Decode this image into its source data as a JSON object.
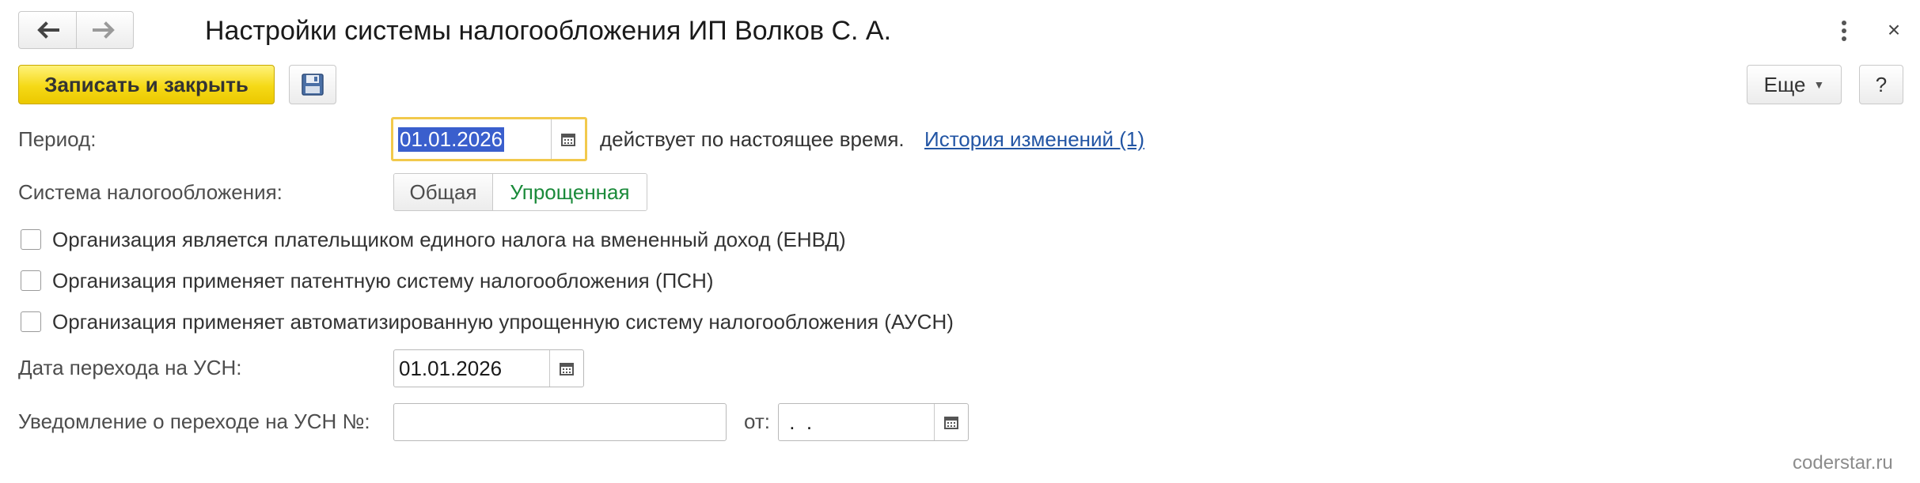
{
  "window": {
    "title": "Настройки системы налогообложения ИП Волков С. А.",
    "close_symbol": "×"
  },
  "toolbar": {
    "save_close_label": "Записать и закрыть",
    "more_label": "Еще",
    "help_label": "?"
  },
  "period": {
    "label": "Период:",
    "value": "01.01.2026",
    "status_text": "действует по настоящее время.",
    "history_link": "История изменений (1)"
  },
  "tax_system": {
    "label": "Система налогообложения:",
    "options": [
      "Общая",
      "Упрощенная"
    ],
    "selected": "Упрощенная"
  },
  "checkboxes": [
    {
      "label": "Организация является плательщиком единого налога на вмененный доход (ЕНВД)",
      "checked": false
    },
    {
      "label": "Организация применяет патентную систему налогообложения (ПСН)",
      "checked": false
    },
    {
      "label": "Организация применяет автоматизированную упрощенную систему налогообложения (АУСН)",
      "checked": false
    }
  ],
  "usn_date": {
    "label": "Дата перехода на УСН:",
    "value": "01.01.2026"
  },
  "notice": {
    "label": "Уведомление о переходе на УСН №:",
    "number_value": "",
    "from_label": "от:",
    "date_value": " .  ."
  },
  "watermark": "coderstar.ru",
  "icons": {
    "back": "arrow-left-icon",
    "forward": "arrow-right-icon",
    "menu": "vertical-dots-icon",
    "close": "close-icon",
    "save": "floppy-disk-icon",
    "calendar": "calendar-icon"
  },
  "colors": {
    "primary_button": "#f5d916",
    "link": "#2255a4",
    "selected_option": "#1a8a3a",
    "focus_border": "#f2c94c",
    "selection": "#3a5fcd"
  }
}
